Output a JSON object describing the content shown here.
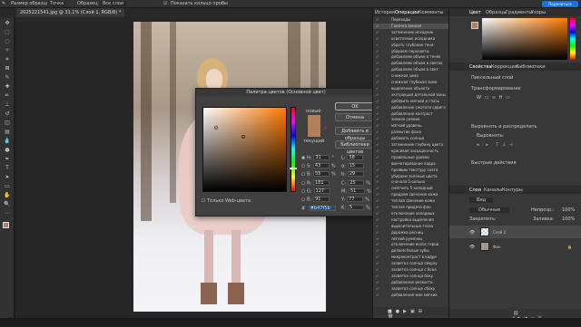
{
  "optbar": {
    "mode": "Размер образца:",
    "sample": "Точка",
    "layers": "Образец:",
    "all_layers": "Все слои",
    "show_ring": "Показать кольцо пробы"
  },
  "document": {
    "tab_title": "2025221541.jpg @ 31,1% (Слой 1, RGB/8) *"
  },
  "status": {
    "zoom": "31,46%",
    "dims": "3648 пикс x 5472 пикс (300 ppi)"
  },
  "picker": {
    "title": "Палитра цветов (Основной цвет)",
    "new_label": "новый",
    "current_label": "текущий",
    "ok": "OK",
    "cancel": "Отмена",
    "add_swatch": "Добавить в образцы",
    "libraries": "Библиотеки цветов",
    "web_only": "Только Web-цвета",
    "fields": {
      "H": "31",
      "S": "43",
      "B": "55",
      "R": "181",
      "G": "127",
      "Bl": "91",
      "L": "58",
      "a": "15",
      "b": "29",
      "C": "25",
      "M": "51",
      "Y": "77",
      "K": "5"
    },
    "hex": "#b47f5b",
    "deg": "°",
    "pct": "%"
  },
  "history": {
    "tab1": "История",
    "tab2": "Операции",
    "tab3": "Комменты",
    "items": [
      "Переходы",
      "Галочка зонная",
      "затемнение исходник",
      "осветление исходника",
      "убрать глубокие тени",
      "убираем пересветы",
      "добавляем объем в тенях",
      "добавляем объем в светах",
      "добавляем объем в свет",
      "снежная зима",
      "снежная глубокая зима",
      "выделение объекта",
      "экстракция детальной зоны",
      "добавить мягкий и глазь",
      "добавление сжатого сдвига",
      "добавление контраст",
      "зимнее сияние",
      "мягкий уровень",
      "размытие фона",
      "добавить солнце",
      "затемнение глубину цвета",
      "красивая насыщенность",
      "правильные уровни",
      "винчетирование кадра",
      "проявим текстуру снега",
      "убираем зеленые цвета",
      "сначала 5-сильно",
      "смягчить 5-холодный",
      "придаем свечение кожа",
      "теплая свечение кожи",
      "теплая придача фон",
      "отключение холодных",
      "настройка выделения",
      "выразительные глаза",
      "дорожка ресниц",
      "легкий румянец",
      "отключение волос герои",
      "делаем белые зубы",
      "микроконтраст в кадре",
      "засветка солнца сверху",
      "засветка солнца с бока",
      "засветка солнца боку",
      "добавление резкости",
      "засветка солнце сбоку",
      "добавление мне мягкие"
    ]
  },
  "right": {
    "colortabs": [
      "Цвет",
      "Образцы",
      "Градиенты",
      "Узоры"
    ],
    "proptabs": [
      "Свойства",
      "Коррекция",
      "Библиотеки"
    ],
    "pixel_layer": "Пиксельный слой",
    "transform": "Трансформирование",
    "align": "Выровнять и распределить",
    "align_lbl": "Выровнять:",
    "quick": "Быстрые действия",
    "layertabs": [
      "Слои",
      "Каналы",
      "Контуры"
    ],
    "kind": "Вид",
    "blend": "Обычные",
    "opacity_lbl": "Непрозр.:",
    "opacity": "100%",
    "lock_lbl": "Закрепить:",
    "fill_lbl": "Заливка:",
    "fill": "100%",
    "layers": [
      {
        "name": "Слой 1"
      },
      {
        "name": "Фон"
      }
    ],
    "share": "Поделиться"
  },
  "colors": {
    "accent": "#1473e6",
    "picked": "#b47f5b",
    "current": "#b37e5a"
  }
}
